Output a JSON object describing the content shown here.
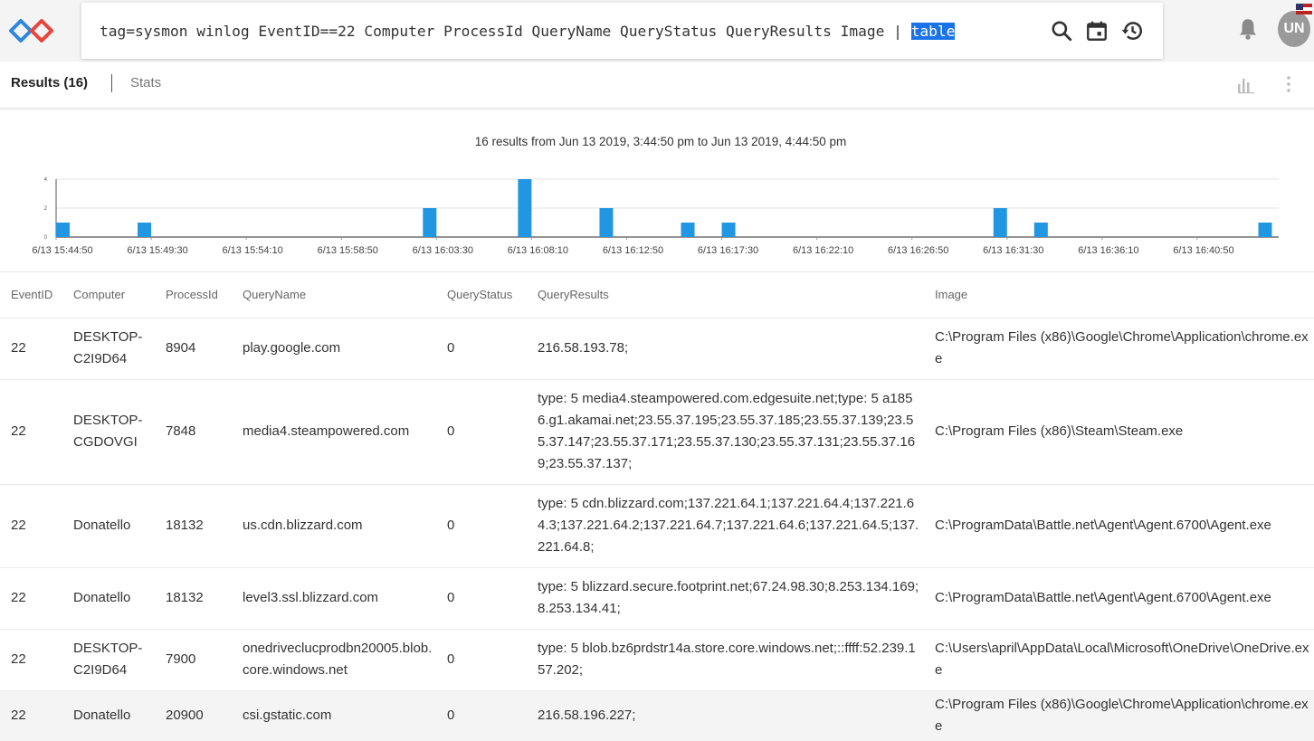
{
  "header": {
    "query_text": "tag=sysmon winlog EventID==22 Computer ProcessId QueryName QueryStatus QueryResults Image | ",
    "query_highlight": "table",
    "icons": [
      "search-icon",
      "calendar-icon",
      "history-icon",
      "bell-icon"
    ],
    "avatar_initials": "UN"
  },
  "tabs": {
    "results_label": "Results (16)",
    "stats_label": "Stats"
  },
  "chart_data": {
    "type": "bar",
    "title": "16 results from Jun 13 2019, 3:44:50 pm to Jun 13 2019, 4:44:50 pm",
    "ylim": [
      0,
      4
    ],
    "yticks": [
      "0",
      "2",
      "4"
    ],
    "x_tick_labels": [
      "6/13 15:44:50",
      "6/13 15:49:30",
      "6/13 15:54:10",
      "6/13 15:58:50",
      "6/13 16:03:30",
      "6/13 16:08:10",
      "6/13 16:12:50",
      "6/13 16:17:30",
      "6/13 16:22:10",
      "6/13 16:26:50",
      "6/13 16:31:30",
      "6/13 16:36:10",
      "6/13 16:40:50"
    ],
    "bars": [
      {
        "x": "15:44:50",
        "value": 1
      },
      {
        "x": "15:48:50",
        "value": 1
      },
      {
        "x": "16:02:50",
        "value": 2
      },
      {
        "x": "16:07:30",
        "value": 4
      },
      {
        "x": "16:11:30",
        "value": 2
      },
      {
        "x": "16:15:30",
        "value": 1
      },
      {
        "x": "16:17:30",
        "value": 1
      },
      {
        "x": "16:30:50",
        "value": 2
      },
      {
        "x": "16:32:50",
        "value": 1
      },
      {
        "x": "16:43:50",
        "value": 1
      }
    ],
    "color": "#2196e3"
  },
  "table": {
    "columns": [
      "EventID",
      "Computer",
      "ProcessId",
      "QueryName",
      "QueryStatus",
      "QueryResults",
      "Image"
    ],
    "rows": [
      [
        "22",
        "DESKTOP-C2I9D64",
        "8904",
        "play.google.com",
        "0",
        "216.58.193.78;",
        "C:\\Program Files (x86)\\Google\\Chrome\\Application\\chrome.exe"
      ],
      [
        "22",
        "DESKTOP-CGDOVGI",
        "7848",
        "media4.steampowered.com",
        "0",
        "type: 5 media4.steampowered.com.edgesuite.net;type: 5 a1856.g1.akamai.net;23.55.37.195;23.55.37.185;23.55.37.139;23.55.37.147;23.55.37.171;23.55.37.130;23.55.37.131;23.55.37.169;23.55.37.137;",
        "C:\\Program Files (x86)\\Steam\\Steam.exe"
      ],
      [
        "22",
        "Donatello",
        "18132",
        "us.cdn.blizzard.com",
        "0",
        "type: 5 cdn.blizzard.com;137.221.64.1;137.221.64.4;137.221.64.3;137.221.64.2;137.221.64.7;137.221.64.6;137.221.64.5;137.221.64.8;",
        "C:\\ProgramData\\Battle.net\\Agent\\Agent.6700\\Agent.exe"
      ],
      [
        "22",
        "Donatello",
        "18132",
        "level3.ssl.blizzard.com",
        "0",
        "type: 5 blizzard.secure.footprint.net;67.24.98.30;8.253.134.169;8.253.134.41;",
        "C:\\ProgramData\\Battle.net\\Agent\\Agent.6700\\Agent.exe"
      ],
      [
        "22",
        "DESKTOP-C2I9D64",
        "7900",
        "onedriveclucprodbn20005.blob.core.windows.net",
        "0",
        "type: 5 blob.bz6prdstr14a.store.core.windows.net;::ffff:52.239.157.202;",
        "C:\\Users\\april\\AppData\\Local\\Microsoft\\OneDrive\\OneDrive.exe"
      ],
      [
        "22",
        "Donatello",
        "20900",
        "csi.gstatic.com",
        "0",
        "216.58.196.227;",
        "C:\\Program Files (x86)\\Google\\Chrome\\Application\\chrome.exe"
      ]
    ]
  }
}
